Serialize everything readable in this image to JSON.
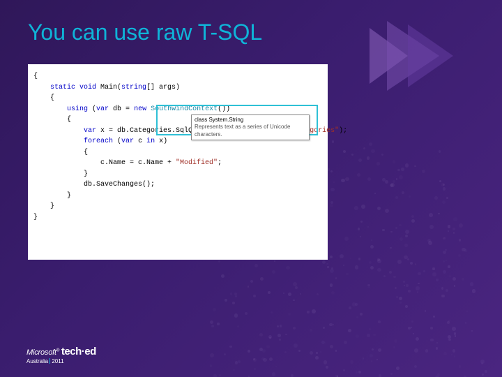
{
  "title": "You can use raw T-SQL",
  "code": {
    "line_sig": "    static void Main(string[] args)",
    "line_using": "        using (var db = new SouthwindContext())",
    "line_query": "            var x = db.Categories.SqlQuery(\"SELECT * FROM dbo.Categories\");",
    "line_foreach": "            foreach (var c in x)",
    "line_assign": "                c.Name = c.Name + \"Modified\";",
    "line_save": "            db.SaveChanges();"
  },
  "tooltip": {
    "head": "class System.String",
    "body": "Represents text as a series of Unicode characters."
  },
  "footer": {
    "brand_prefix": "Microsoft",
    "brand_main": "tech·ed",
    "region": "Australia",
    "year": "2011"
  }
}
